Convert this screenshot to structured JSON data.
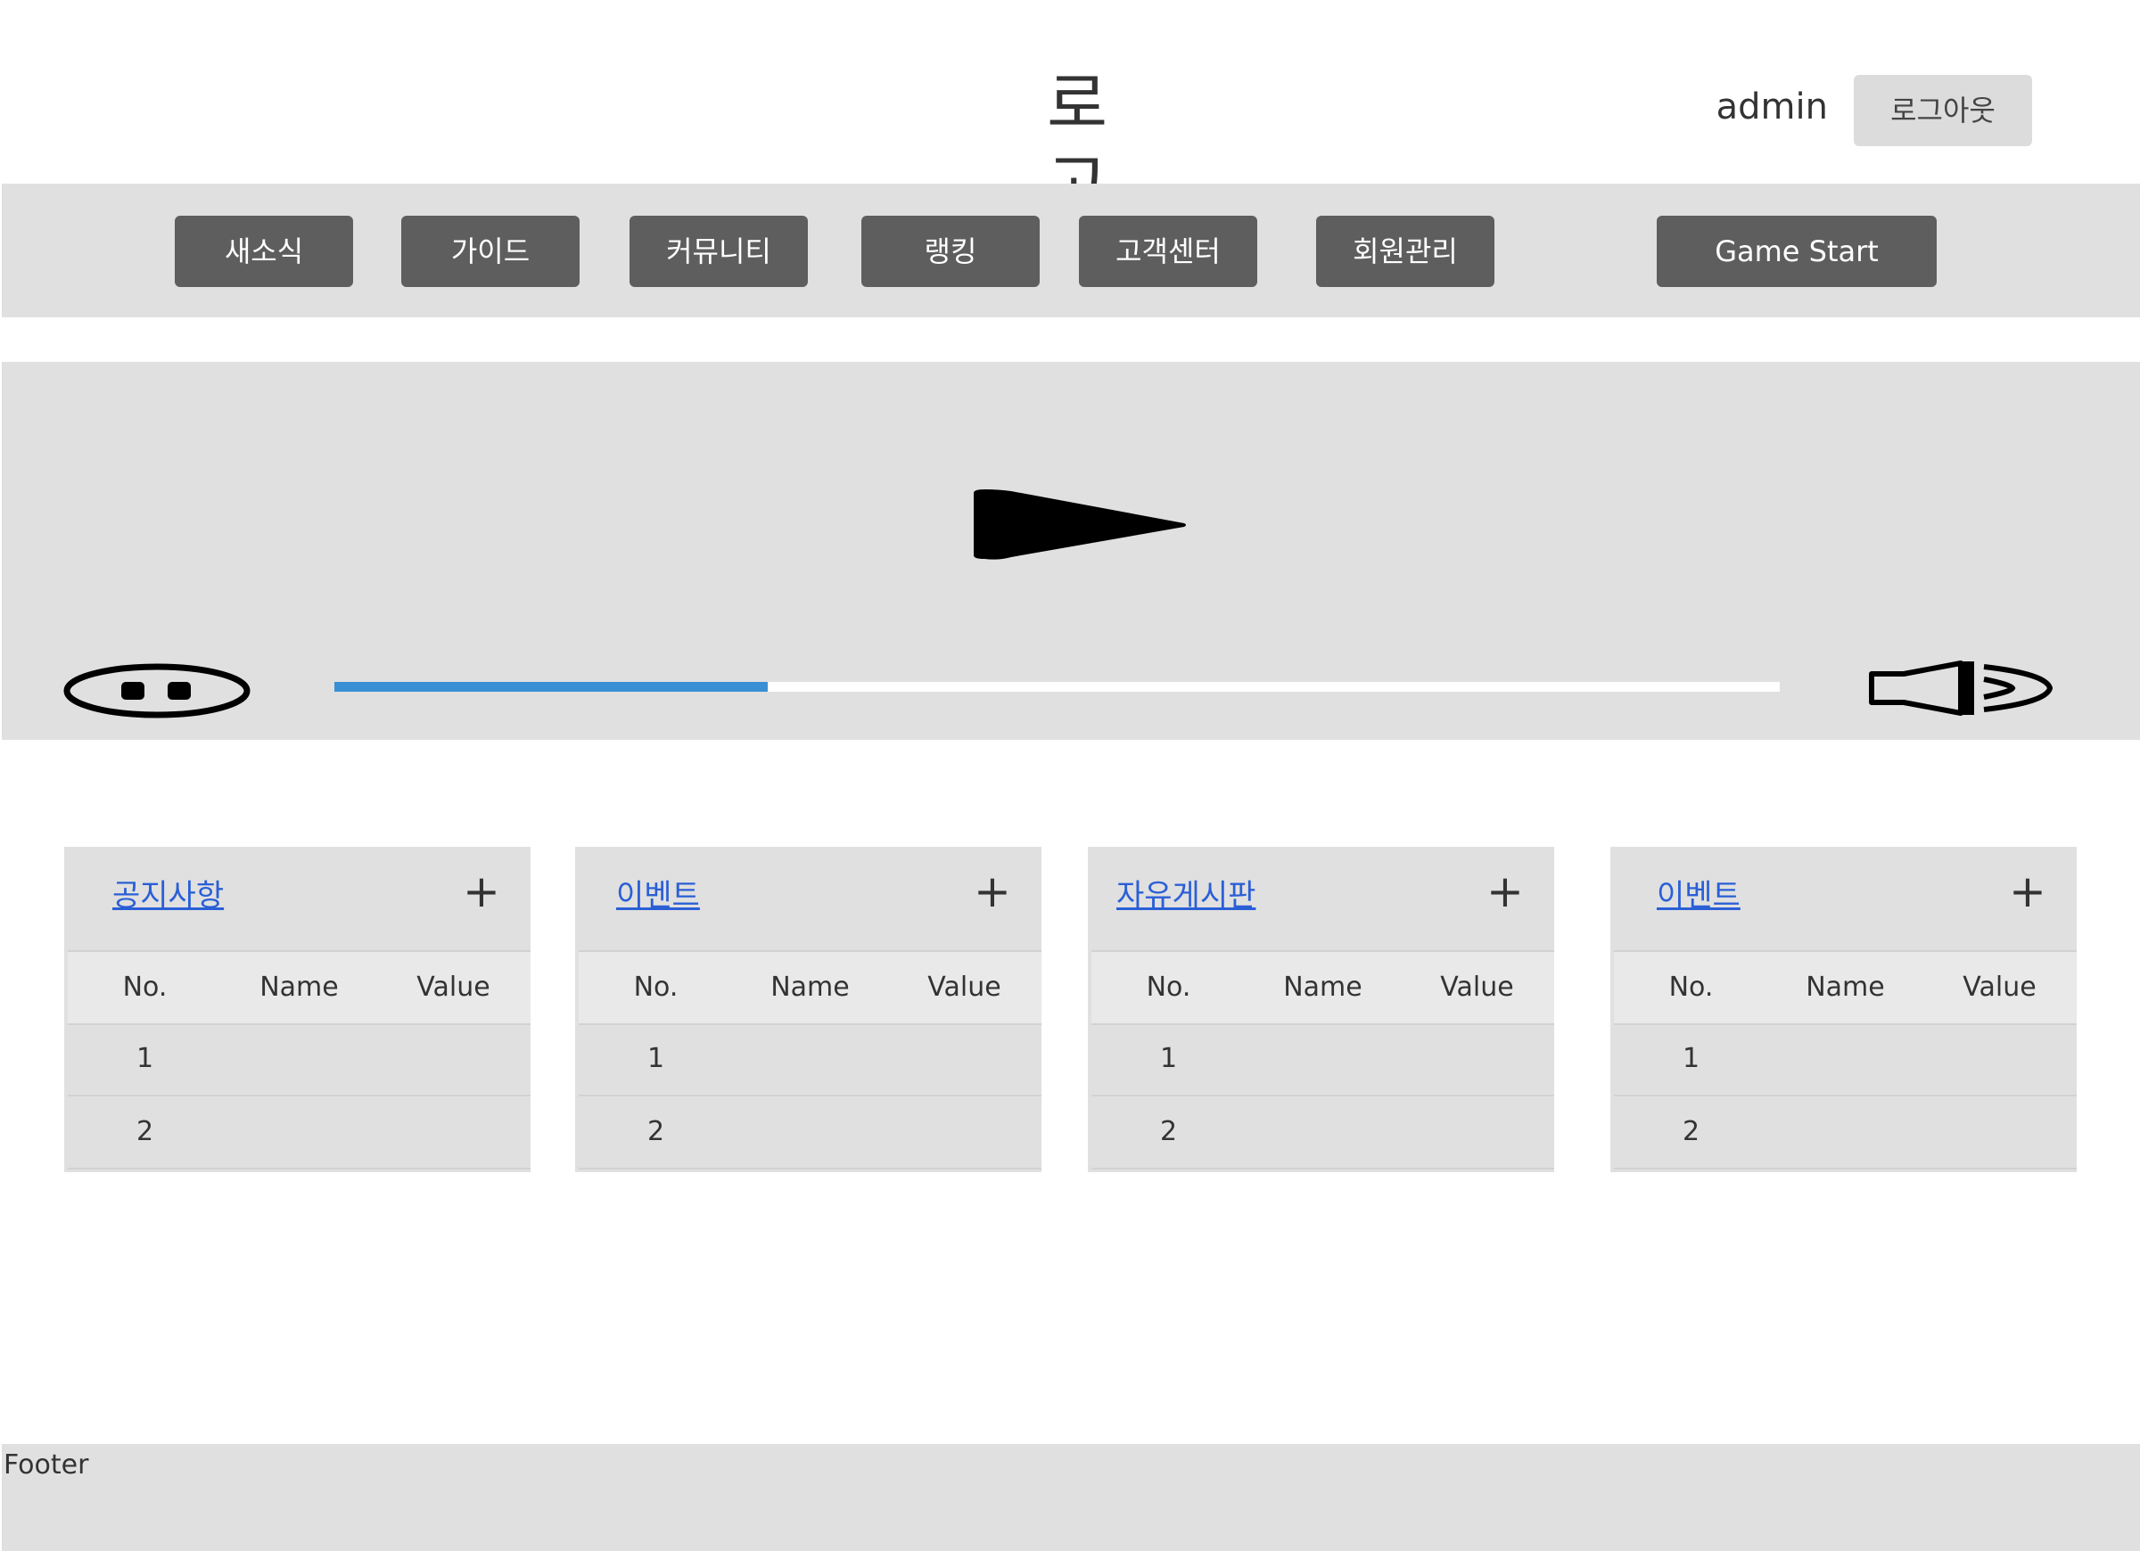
{
  "header": {
    "logo": "로고",
    "username": "admin",
    "logout_label": "로그아웃"
  },
  "nav": {
    "items": [
      "새소식",
      "가이드",
      "커뮤니티",
      "랭킹",
      "고객센터",
      "회원관리"
    ],
    "game_start_label": "Game Start"
  },
  "player": {
    "icons": [
      "play-icon",
      "pause-icon",
      "volume-icon"
    ],
    "progress": 0.3,
    "progress_color": "#3a8fd4"
  },
  "boards": [
    {
      "title": "공지사항",
      "plus": "+",
      "columns": [
        "No.",
        "Name",
        "Value"
      ],
      "rows": [
        [
          "1",
          "",
          ""
        ],
        [
          "2",
          "",
          ""
        ]
      ]
    },
    {
      "title": "이벤트",
      "plus": "+",
      "columns": [
        "No.",
        "Name",
        "Value"
      ],
      "rows": [
        [
          "1",
          "",
          ""
        ],
        [
          "2",
          "",
          ""
        ]
      ]
    },
    {
      "title": "자유게시판",
      "plus": "+",
      "columns": [
        "No.",
        "Name",
        "Value"
      ],
      "rows": [
        [
          "1",
          "",
          ""
        ],
        [
          "2",
          "",
          ""
        ]
      ]
    },
    {
      "title": "이벤트",
      "plus": "+",
      "columns": [
        "No.",
        "Name",
        "Value"
      ],
      "rows": [
        [
          "1",
          "",
          ""
        ],
        [
          "2",
          "",
          ""
        ]
      ]
    }
  ],
  "footer": {
    "label": "Footer"
  }
}
